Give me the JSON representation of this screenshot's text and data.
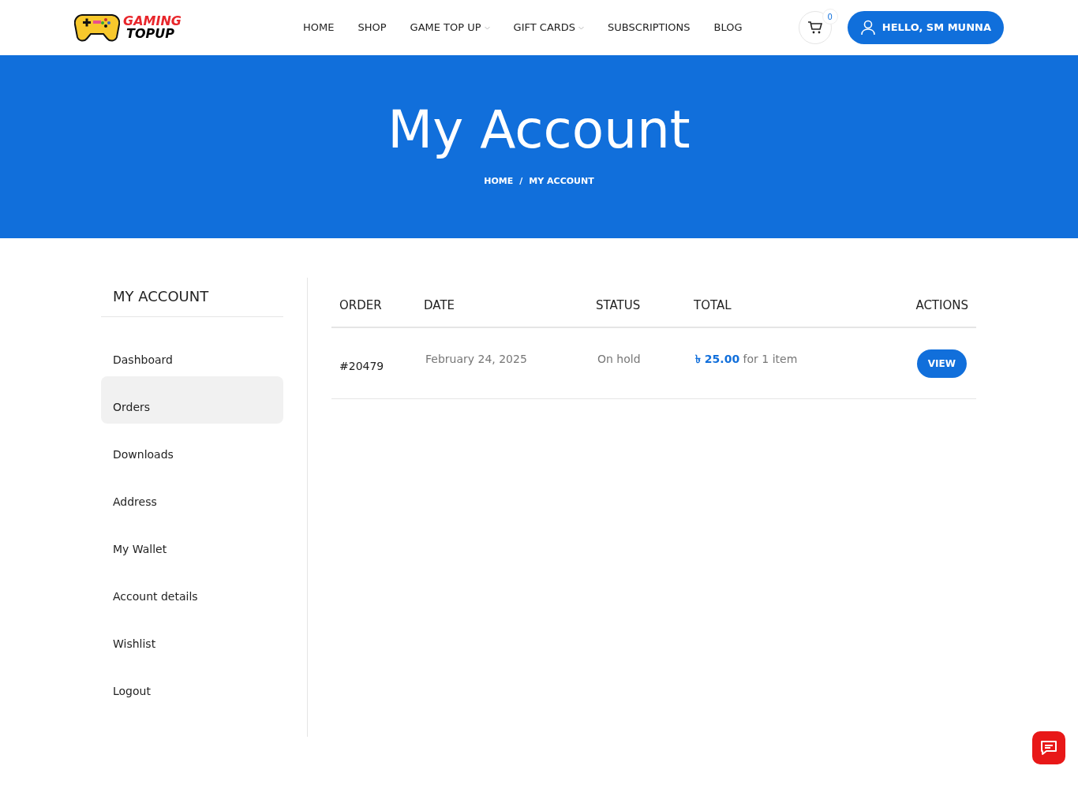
{
  "logo": {
    "line_1": "GAMING",
    "line_2": "TOPUP"
  },
  "nav": [
    {
      "label": "HOME",
      "dropdown": false
    },
    {
      "label": "SHOP",
      "dropdown": false
    },
    {
      "label": "GAME TOP UP",
      "dropdown": true
    },
    {
      "label": "GIFT CARDS",
      "dropdown": true
    },
    {
      "label": "SUBSCRIPTIONS",
      "dropdown": false
    },
    {
      "label": "BLOG",
      "dropdown": false
    }
  ],
  "cart": {
    "count": "0"
  },
  "account_button": "HELLO, SM MUNNA",
  "hero": {
    "title": "My Account",
    "breadcrumb": [
      "HOME",
      "/",
      "MY ACCOUNT"
    ]
  },
  "sidebar": {
    "title": "MY ACCOUNT",
    "items": [
      {
        "label": "Dashboard",
        "selected": false
      },
      {
        "label": "Orders",
        "selected": true
      },
      {
        "label": "Downloads",
        "selected": false
      },
      {
        "label": "Address",
        "selected": false
      },
      {
        "label": "My Wallet",
        "selected": false
      },
      {
        "label": "Account details",
        "selected": false
      },
      {
        "label": "Wishlist",
        "selected": false
      },
      {
        "label": "Logout",
        "selected": false
      }
    ]
  },
  "table": {
    "columns": [
      "ORDER",
      "DATE",
      "STATUS",
      "TOTAL",
      "ACTIONS"
    ],
    "rows": [
      {
        "order": "#20479",
        "date": "February 24, 2025",
        "status": "On hold",
        "total": "**৳ 25.00** for 1 item",
        "action": "VIEW"
      }
    ]
  }
}
